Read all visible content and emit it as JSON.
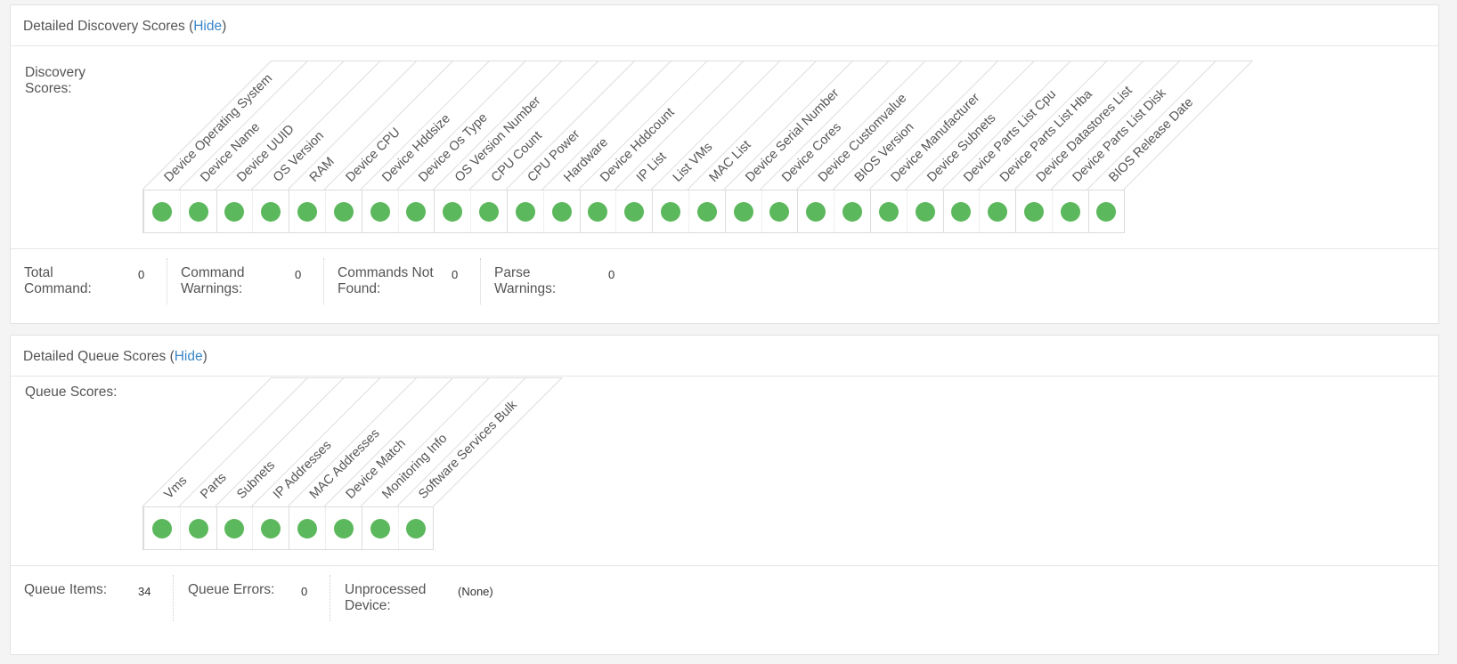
{
  "discovery": {
    "title": "Detailed Discovery Scores (",
    "hide_label": "Hide",
    "title_close": ")",
    "row_label": "Discovery Scores:",
    "columns": [
      {
        "label": "Device Operating System",
        "status": "ok"
      },
      {
        "label": "Device Name",
        "status": "ok"
      },
      {
        "label": "Device UUID",
        "status": "ok"
      },
      {
        "label": "OS Version",
        "status": "ok"
      },
      {
        "label": "RAM",
        "status": "ok"
      },
      {
        "label": "Device CPU",
        "status": "ok"
      },
      {
        "label": "Device Hddsize",
        "status": "ok"
      },
      {
        "label": "Device Os Type",
        "status": "ok"
      },
      {
        "label": "OS Version Number",
        "status": "ok"
      },
      {
        "label": "CPU Count",
        "status": "ok"
      },
      {
        "label": "CPU Power",
        "status": "ok"
      },
      {
        "label": "Hardware",
        "status": "ok"
      },
      {
        "label": "Device Hddcount",
        "status": "ok"
      },
      {
        "label": "IP List",
        "status": "ok"
      },
      {
        "label": "List VMs",
        "status": "ok"
      },
      {
        "label": "MAC List",
        "status": "ok"
      },
      {
        "label": "Device Serial Number",
        "status": "ok"
      },
      {
        "label": "Device Cores",
        "status": "ok"
      },
      {
        "label": "Device Customvalue",
        "status": "ok"
      },
      {
        "label": "BIOS Version",
        "status": "ok"
      },
      {
        "label": "Device Manufacturer",
        "status": "ok"
      },
      {
        "label": "Device Subnets",
        "status": "ok"
      },
      {
        "label": "Device Parts List Cpu",
        "status": "ok"
      },
      {
        "label": "Device Parts List Hba",
        "status": "ok"
      },
      {
        "label": "Device Datastores List",
        "status": "ok"
      },
      {
        "label": "Device Parts List Disk",
        "status": "ok"
      },
      {
        "label": "BIOS Release Date",
        "status": "ok"
      }
    ],
    "stats": [
      {
        "label_line1": "Total",
        "label_line2": "Command:",
        "value": "0"
      },
      {
        "label_line1": "Command",
        "label_line2": "Warnings:",
        "value": "0"
      },
      {
        "label_line1": "Commands Not",
        "label_line2": "Found:",
        "value": "0"
      },
      {
        "label_line1": "Parse",
        "label_line2": "Warnings:",
        "value": "0"
      }
    ]
  },
  "queue": {
    "title": "Detailed Queue Scores (",
    "hide_label": "Hide",
    "title_close": ")",
    "row_label": "Queue Scores:",
    "columns": [
      {
        "label": "Vms",
        "status": "ok"
      },
      {
        "label": "Parts",
        "status": "ok"
      },
      {
        "label": "Subnets",
        "status": "ok"
      },
      {
        "label": "IP Addresses",
        "status": "ok"
      },
      {
        "label": "MAC Addresses",
        "status": "ok"
      },
      {
        "label": "Device Match",
        "status": "ok"
      },
      {
        "label": "Monitoring Info",
        "status": "ok"
      },
      {
        "label": "Software Services Bulk",
        "status": "ok"
      }
    ],
    "stats": [
      {
        "label_line1": "Queue Items:",
        "label_line2": "",
        "value": "34"
      },
      {
        "label_line1": "Queue Errors:",
        "label_line2": "",
        "value": "0"
      },
      {
        "label_line1": "Unprocessed",
        "label_line2": "Device:",
        "value": "(None)"
      }
    ]
  },
  "colors": {
    "status_ok": "#5cb85c",
    "link": "#3a87c8"
  }
}
